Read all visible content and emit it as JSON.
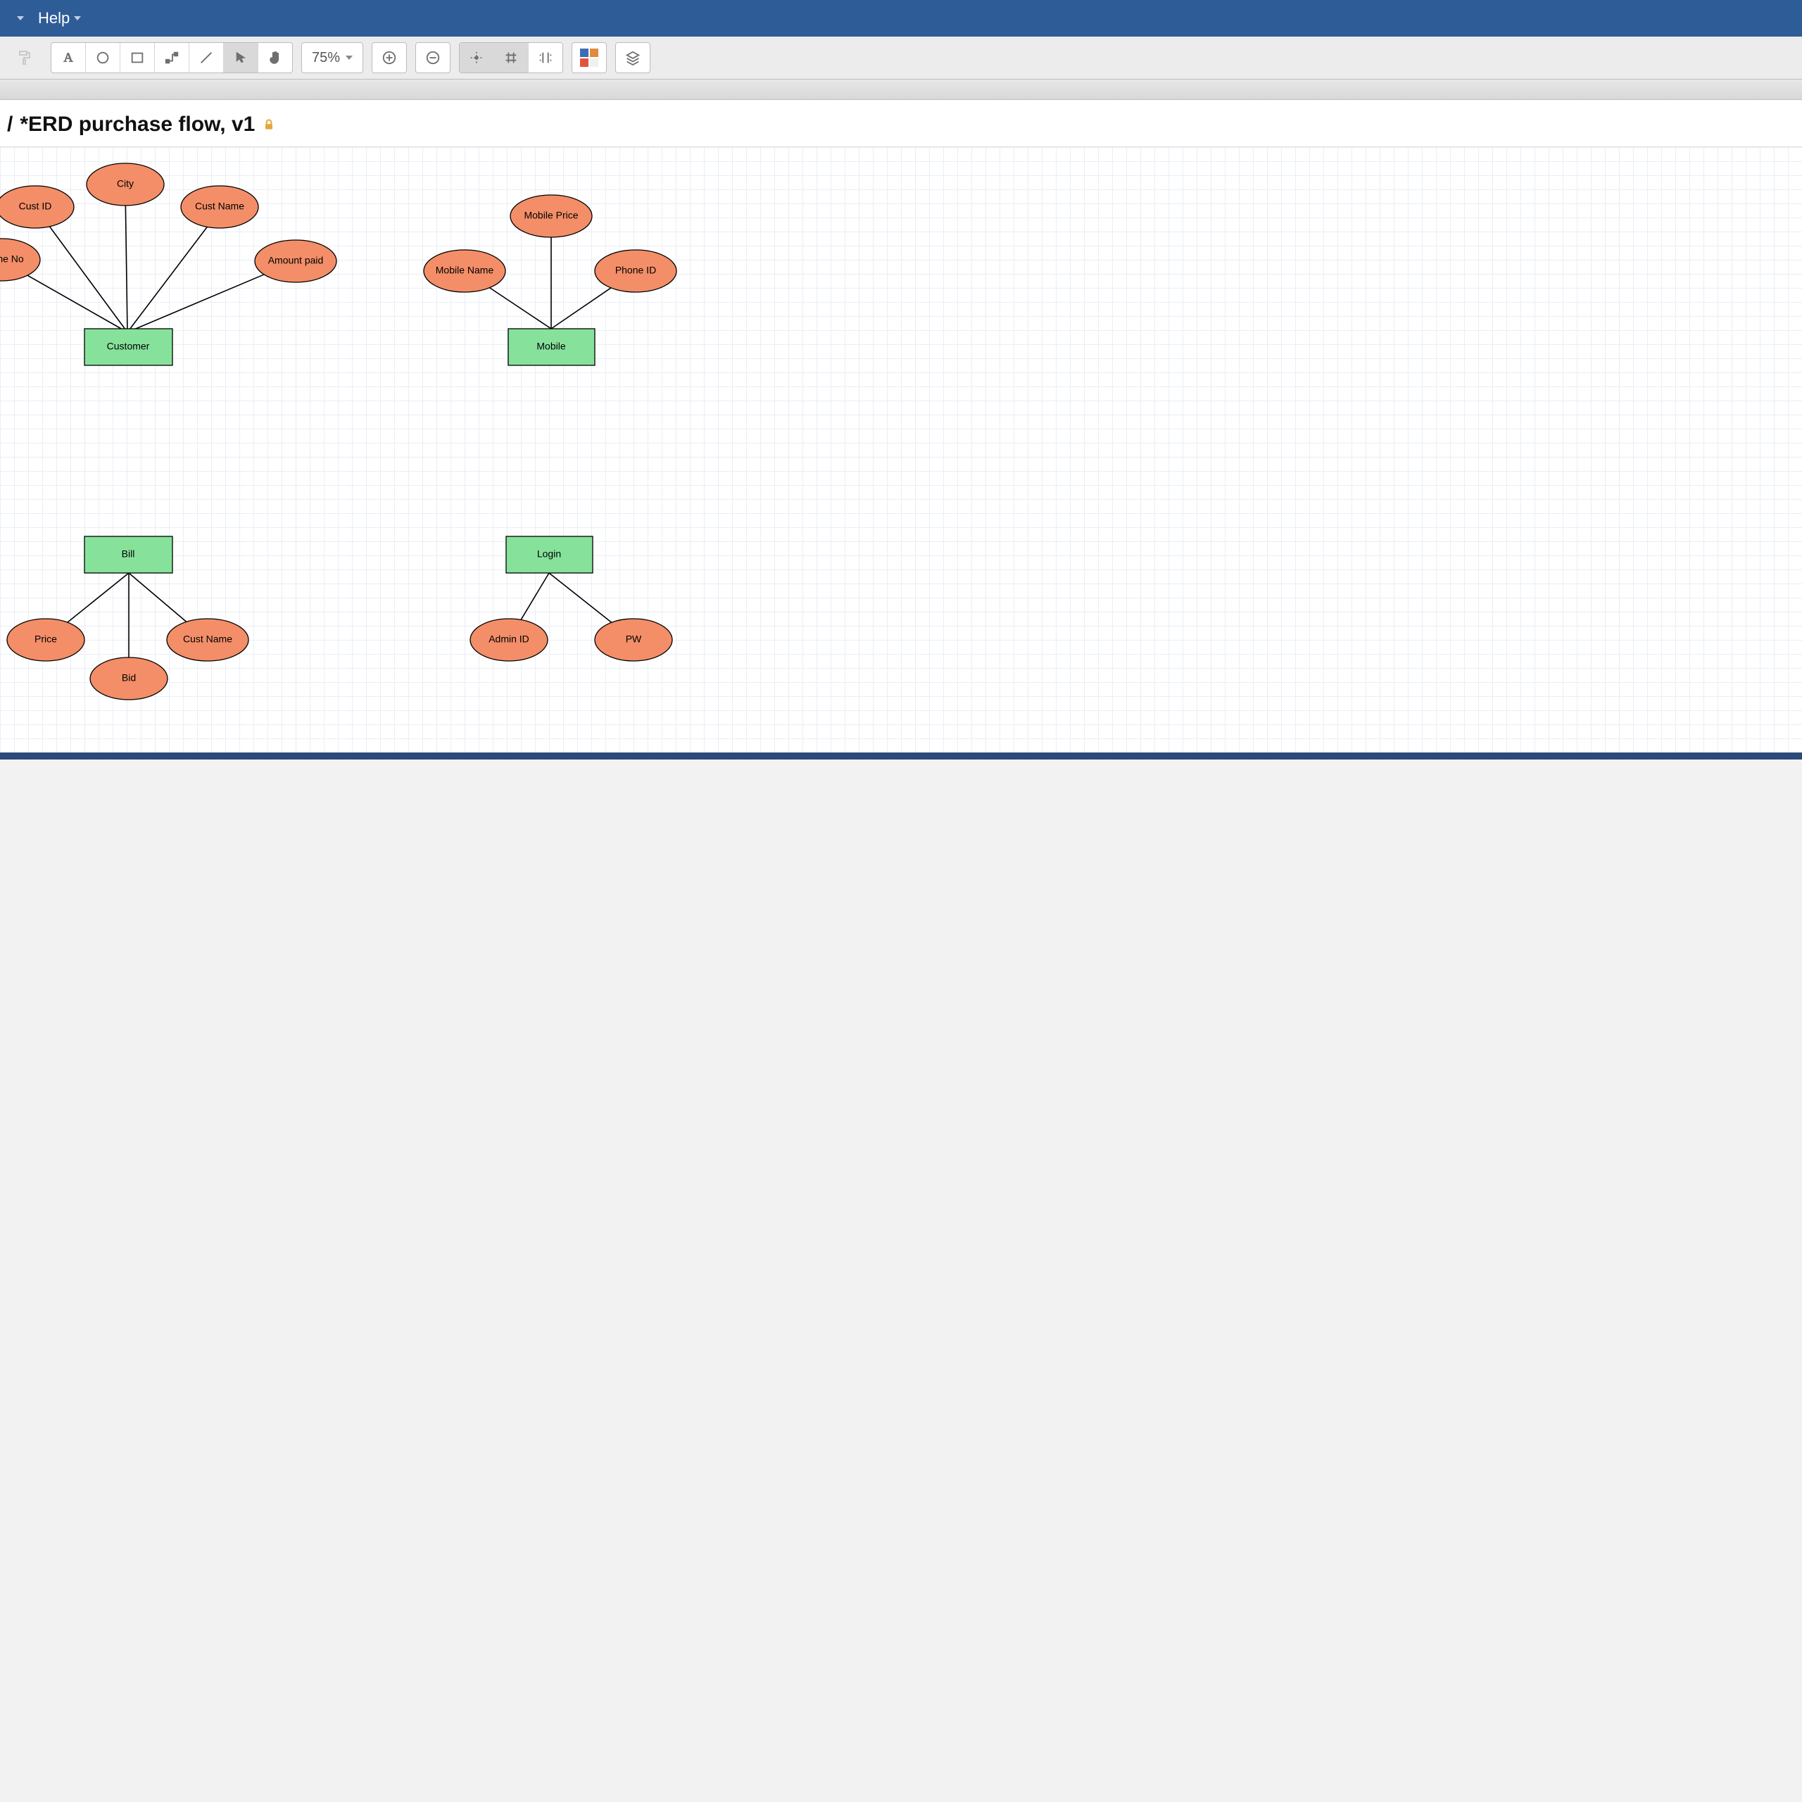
{
  "menubar": {
    "help": "Help"
  },
  "toolbar": {
    "zoom_label": "75%",
    "icons": {
      "paint": "paint-format-icon",
      "text": "text-icon",
      "circle": "circle-icon",
      "rect": "rectangle-icon",
      "connector": "connector-icon",
      "line": "line-icon",
      "pointer": "pointer-icon",
      "pan": "pan-hand-icon",
      "zoom_in": "zoom-in-icon",
      "zoom_out": "zoom-out-icon",
      "snap_point": "snap-point-icon",
      "snap_grid": "snap-grid-icon",
      "snap_edge": "snap-edge-icon",
      "palette": "palette-icon",
      "layers": "layers-icon"
    }
  },
  "doc": {
    "breadcrumb_prefix": "/ ",
    "title": "*ERD purchase flow, v1",
    "locked": true
  },
  "erd": {
    "entities": {
      "customer": {
        "label": "Customer",
        "attrs": [
          "Cust ID",
          "City",
          "Cust Name",
          "Amount paid",
          "ne No"
        ]
      },
      "mobile": {
        "label": "Mobile",
        "attrs": [
          "Mobile Name",
          "Mobile Price",
          "Phone ID"
        ]
      },
      "bill": {
        "label": "Bill",
        "attrs": [
          "Price",
          "Bid",
          "Cust Name"
        ]
      },
      "login": {
        "label": "Login",
        "attrs": [
          "Admin ID",
          "PW"
        ]
      }
    }
  },
  "colors": {
    "entity": "#86e29b",
    "attribute": "#f38e68",
    "menubar": "#2e5c97"
  }
}
